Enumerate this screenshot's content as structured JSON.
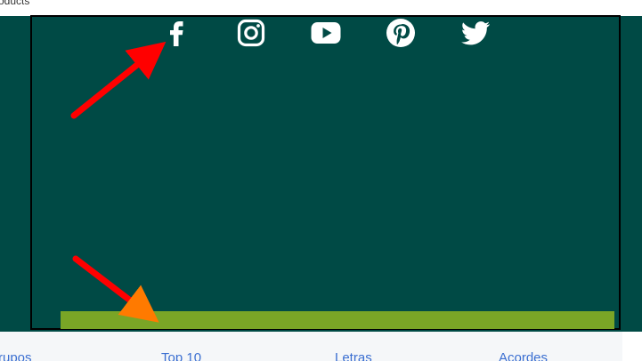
{
  "topbar": {
    "text": "oducts"
  },
  "footer": {
    "social": [
      {
        "name": "facebook-icon"
      },
      {
        "name": "instagram-icon"
      },
      {
        "name": "youtube-icon"
      },
      {
        "name": "pinterest-icon"
      },
      {
        "name": "twitter-icon"
      }
    ]
  },
  "nav": {
    "items": [
      {
        "label": "rupos"
      },
      {
        "label": "Top 10"
      },
      {
        "label": "Letras"
      },
      {
        "label": "Acordes"
      }
    ]
  },
  "colors": {
    "footer_bg": "#004a45",
    "accent_bar": "#7aa526",
    "link": "#3b6fd1",
    "annotation_arrow": "#ff0000"
  }
}
